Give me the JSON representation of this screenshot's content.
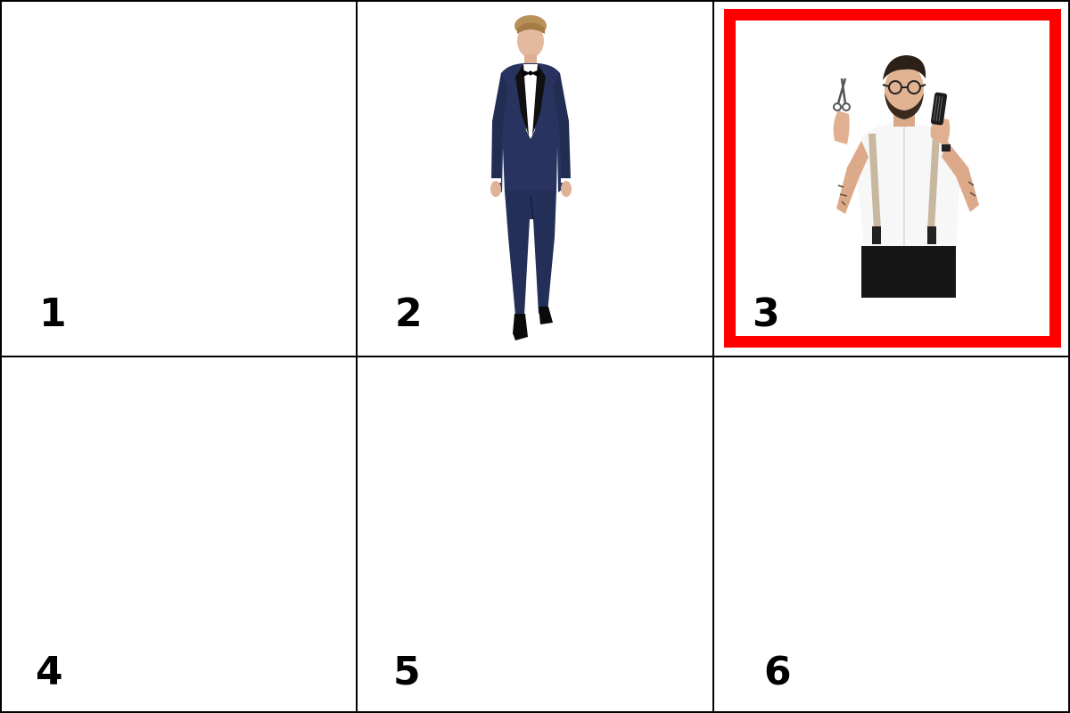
{
  "grid": {
    "cells": [
      {
        "number": "1",
        "content": "empty",
        "selected": false
      },
      {
        "number": "2",
        "content": "man-in-tuxedo-image",
        "selected": false
      },
      {
        "number": "3",
        "content": "barber-with-scissors-and-comb-image",
        "selected": true
      },
      {
        "number": "4",
        "content": "empty",
        "selected": false
      },
      {
        "number": "5",
        "content": "empty",
        "selected": false
      },
      {
        "number": "6",
        "content": "empty",
        "selected": false
      }
    ]
  },
  "colors": {
    "background": "#ffffff",
    "grid_line": "#000000",
    "selection": "#ff0000",
    "number_text": "#000000"
  }
}
